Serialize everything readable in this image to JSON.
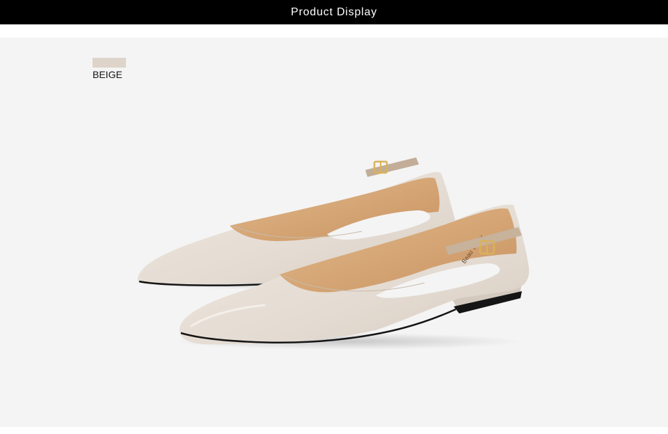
{
  "header": {
    "title": "Product Display"
  },
  "color_option": {
    "label": "BEIGE",
    "swatch_color": "#dfd4ca"
  },
  "product": {
    "inner_brand_text": "Beau Today",
    "colors": {
      "leather": "#e8e0d8",
      "leather_shadow": "#d2c8bd",
      "lining": "#d9ab7c",
      "lining_dark": "#c8955f",
      "sole": "#111111",
      "buckle": "#d9b25a",
      "background": "#f4f4f4"
    }
  }
}
